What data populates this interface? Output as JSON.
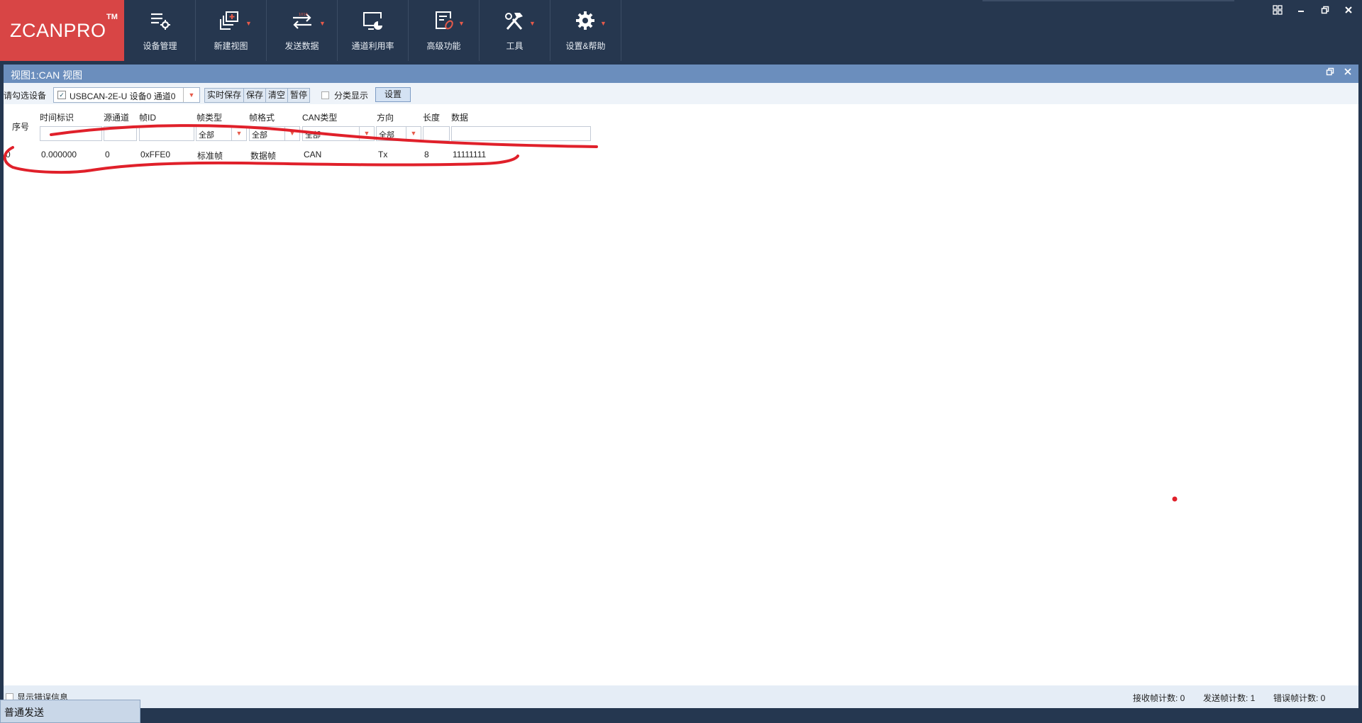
{
  "app": {
    "logo_text": "ZCANPRO",
    "logo_tm": "TM"
  },
  "toolbar": [
    {
      "label": "设备管理",
      "icon": "device-manager-icon"
    },
    {
      "label": "新建视图",
      "icon": "new-view-icon"
    },
    {
      "label": "发送数据",
      "icon": "send-data-icon"
    },
    {
      "label": "通道利用率",
      "icon": "channel-usage-icon"
    },
    {
      "label": "高级功能",
      "icon": "advanced-icon"
    },
    {
      "label": "工具",
      "icon": "tools-icon"
    },
    {
      "label": "设置&帮助",
      "icon": "settings-icon"
    }
  ],
  "window_controls": [
    "layout-icon",
    "minimize-icon",
    "restore-icon",
    "close-icon"
  ],
  "view": {
    "title": "视图1:CAN 视图",
    "device_label": "请勾选设备",
    "device_value": "USBCAN-2E-U 设备0 通道0",
    "buttons": [
      "实时保存",
      "保存",
      "清空",
      "暂停"
    ],
    "classify_label": "分类显示",
    "settings_label": "设置"
  },
  "grid": {
    "columns": [
      "序号",
      "时间标识",
      "源通道",
      "帧ID",
      "帧类型",
      "帧格式",
      "CAN类型",
      "方向",
      "长度",
      "数据"
    ],
    "filters": {
      "frame_type": "全部",
      "frame_format": "全部",
      "can_type": "全部",
      "direction": "全部"
    },
    "rows": [
      [
        "0",
        "0.000000",
        "0",
        "0xFFE0",
        "标准帧",
        "数据帧",
        "CAN",
        "Tx",
        "8",
        "11111111"
      ]
    ]
  },
  "bottom": {
    "error_label": "显示错误信息",
    "send_tab": "普通发送",
    "rx_label": "接收帧计数: 0",
    "tx_label": "发送帧计数: 1",
    "err_label": "错误帧计数: 0"
  },
  "colors": {
    "ribbon": "#26374f",
    "logo": "#d84545",
    "view_title": "#6b8ebd",
    "annotation": "#e0202a"
  }
}
